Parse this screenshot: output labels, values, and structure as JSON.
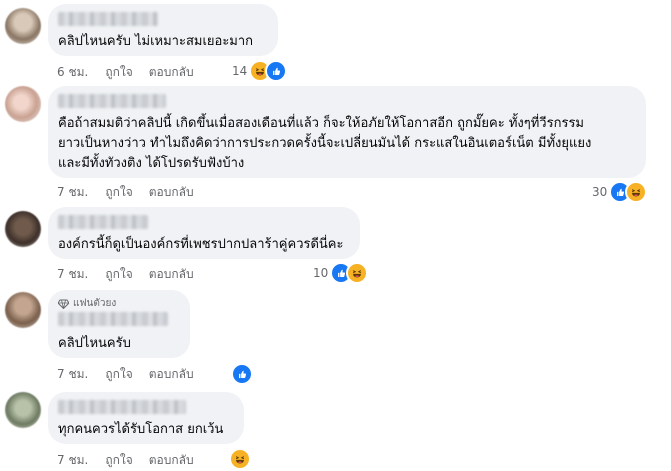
{
  "comments": [
    {
      "text": [
        "คลิปไหนครับ ไม่เหมาะสมเยอะมาก"
      ],
      "time": "6 ชม.",
      "like_label": "ถูกใจ",
      "reply_label": "ตอบกลับ",
      "reaction_count": "14",
      "reactions": [
        "haha-icon",
        "like-icon"
      ]
    },
    {
      "text": [
        "คือถ้าสมมติว่าคลิปนี้ เกิดขึ้นเมื่อสองเดือนที่แล้ว ก็จะให้อภัยให้โอกาสอีก ถูกมั๊ยคะ ทั้งๆที่วีรกรรม",
        "ยาวเป็นหางว่าว ทำไมถึงคิดว่าการประกวดครั้งนี้จะเปลี่ยนมันได้ กระแสในอินเตอร์เน็ต มีทั้งยุแยง",
        "และมีทั้งทัวงติง ได้โปรดรับฟังบ้าง"
      ],
      "time": "7 ชม.",
      "like_label": "ถูกใจ",
      "reply_label": "ตอบกลับ",
      "reaction_count": "30",
      "reactions": [
        "like-icon",
        "haha-icon"
      ]
    },
    {
      "text": [
        "องค์กรนี้ก็ดูเป็นองค์กรที่เพชรปากปลาร้าคู่ควรดีนี่คะ"
      ],
      "time": "7 ชม.",
      "like_label": "ถูกใจ",
      "reply_label": "ตอบกลับ",
      "reaction_count": "10",
      "reactions": [
        "like-icon",
        "haha-icon"
      ]
    },
    {
      "badge": "แฟนตัวยง",
      "text": [
        "คลิปไหนครับ"
      ],
      "time": "7 ชม.",
      "like_label": "ถูกใจ",
      "reply_label": "ตอบกลับ",
      "reaction_count": "",
      "reactions": [
        "like-icon"
      ]
    },
    {
      "text": [
        "ทุกคนควรได้รับโอกาส ยกเว้น"
      ],
      "time": "7 ชม.",
      "like_label": "ถูกใจ",
      "reply_label": "ตอบกลับ",
      "reaction_count": "",
      "reactions": [
        "haha-icon"
      ]
    }
  ],
  "colors": {
    "bubble": "#f0f2f5",
    "meta_text": "#65676b",
    "like_blue": "#1877f2",
    "haha_yellow": "#f7b125"
  }
}
